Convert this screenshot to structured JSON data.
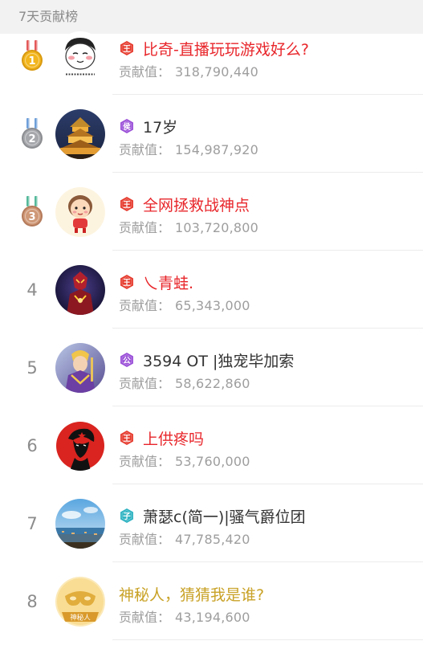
{
  "header": {
    "title": "7天贡献榜"
  },
  "colors": {
    "vip_name": "#e8262b",
    "normal_name": "#333333",
    "mystery_name": "#c9a227",
    "gold": "#f1b41b",
    "silver": "#9e9fa3",
    "bronze": "#c99070"
  },
  "list": {
    "contrib_label": "贡献值：",
    "rows": [
      {
        "rank": "1",
        "medal": "gold",
        "badge": "王",
        "badge_color": "red",
        "name": "比奇-直播玩玩游戏好么?",
        "name_color": "#e8262b",
        "value": "318,790,440",
        "avatar": "meme-face"
      },
      {
        "rank": "2",
        "medal": "silver",
        "badge": "侯",
        "badge_color": "purple",
        "name": "17岁",
        "name_color": "#333333",
        "value": "154,987,920",
        "avatar": "palace-night"
      },
      {
        "rank": "3",
        "medal": "bronze",
        "badge": "王",
        "badge_color": "red",
        "name": "全网拯救战神点",
        "name_color": "#e8262b",
        "value": "103,720,800",
        "avatar": "cartoon-boy"
      },
      {
        "rank": "4",
        "medal": "",
        "badge": "王",
        "badge_color": "red",
        "name": "乀青蛙.",
        "name_color": "#e8262b",
        "value": "65,343,000",
        "avatar": "armored-hero"
      },
      {
        "rank": "5",
        "medal": "",
        "badge": "公",
        "badge_color": "purple",
        "name": "3594 OT |独宠毕加索",
        "name_color": "#333333",
        "value": "58,622,860",
        "avatar": "golden-warrior"
      },
      {
        "rank": "6",
        "medal": "",
        "badge": "王",
        "badge_color": "red",
        "name": "上供疼吗",
        "name_color": "#e8262b",
        "value": "53,760,000",
        "avatar": "red-portrait"
      },
      {
        "rank": "7",
        "medal": "",
        "badge": "子",
        "badge_color": "teal",
        "name": "萧瑟c(简一)|骚气爵位团",
        "name_color": "#333333",
        "value": "47,785,420",
        "avatar": "seaside"
      },
      {
        "rank": "8",
        "medal": "",
        "badge": "",
        "badge_color": "",
        "name": "神秘人，猜猜我是谁?",
        "name_color": "#c9a227",
        "value": "43,194,600",
        "avatar": "mystery-mask",
        "avatar_label": "神秘人"
      }
    ]
  }
}
